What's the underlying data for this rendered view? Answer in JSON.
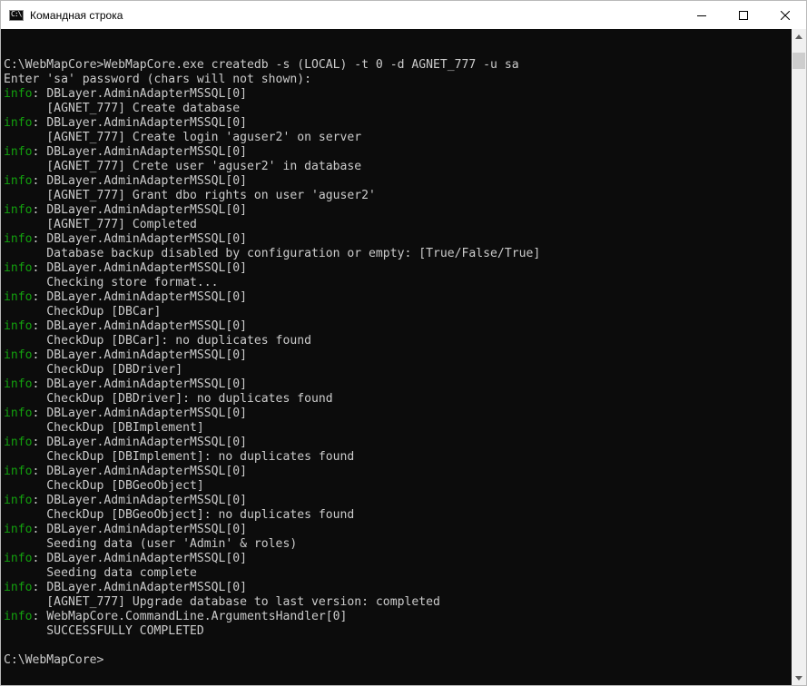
{
  "window": {
    "title": "Командная строка",
    "icon": "cmd-icon",
    "icon_glyph": "C:\\",
    "controls": {
      "minimize_icon": "minimize-icon",
      "maximize_icon": "maximize-icon",
      "close_icon": "close-icon"
    }
  },
  "colors": {
    "background": "#0c0c0c",
    "text": "#cccccc",
    "info_level": "#13a10e",
    "titlebar": "#ffffff"
  },
  "console": {
    "lines": [
      {
        "level": "",
        "text": ""
      },
      {
        "level": "",
        "text": "C:\\WebMapCore>WebMapCore.exe createdb -s (LOCAL) -t 0 -d AGNET_777 -u sa"
      },
      {
        "level": "",
        "text": "Enter 'sa' password (chars will not shown):"
      },
      {
        "level": "info",
        "text": ": DBLayer.AdminAdapterMSSQL[0]"
      },
      {
        "level": "",
        "text": "      [AGNET_777] Create database"
      },
      {
        "level": "info",
        "text": ": DBLayer.AdminAdapterMSSQL[0]"
      },
      {
        "level": "",
        "text": "      [AGNET_777] Create login 'aguser2' on server"
      },
      {
        "level": "info",
        "text": ": DBLayer.AdminAdapterMSSQL[0]"
      },
      {
        "level": "",
        "text": "      [AGNET_777] Crete user 'aguser2' in database"
      },
      {
        "level": "info",
        "text": ": DBLayer.AdminAdapterMSSQL[0]"
      },
      {
        "level": "",
        "text": "      [AGNET_777] Grant dbo rights on user 'aguser2'"
      },
      {
        "level": "info",
        "text": ": DBLayer.AdminAdapterMSSQL[0]"
      },
      {
        "level": "",
        "text": "      [AGNET_777] Completed"
      },
      {
        "level": "info",
        "text": ": DBLayer.AdminAdapterMSSQL[0]"
      },
      {
        "level": "",
        "text": "      Database backup disabled by configuration or empty: [True/False/True]"
      },
      {
        "level": "info",
        "text": ": DBLayer.AdminAdapterMSSQL[0]"
      },
      {
        "level": "",
        "text": "      Checking store format..."
      },
      {
        "level": "info",
        "text": ": DBLayer.AdminAdapterMSSQL[0]"
      },
      {
        "level": "",
        "text": "      CheckDup [DBCar]"
      },
      {
        "level": "info",
        "text": ": DBLayer.AdminAdapterMSSQL[0]"
      },
      {
        "level": "",
        "text": "      CheckDup [DBCar]: no duplicates found"
      },
      {
        "level": "info",
        "text": ": DBLayer.AdminAdapterMSSQL[0]"
      },
      {
        "level": "",
        "text": "      CheckDup [DBDriver]"
      },
      {
        "level": "info",
        "text": ": DBLayer.AdminAdapterMSSQL[0]"
      },
      {
        "level": "",
        "text": "      CheckDup [DBDriver]: no duplicates found"
      },
      {
        "level": "info",
        "text": ": DBLayer.AdminAdapterMSSQL[0]"
      },
      {
        "level": "",
        "text": "      CheckDup [DBImplement]"
      },
      {
        "level": "info",
        "text": ": DBLayer.AdminAdapterMSSQL[0]"
      },
      {
        "level": "",
        "text": "      CheckDup [DBImplement]: no duplicates found"
      },
      {
        "level": "info",
        "text": ": DBLayer.AdminAdapterMSSQL[0]"
      },
      {
        "level": "",
        "text": "      CheckDup [DBGeoObject]"
      },
      {
        "level": "info",
        "text": ": DBLayer.AdminAdapterMSSQL[0]"
      },
      {
        "level": "",
        "text": "      CheckDup [DBGeoObject]: no duplicates found"
      },
      {
        "level": "info",
        "text": ": DBLayer.AdminAdapterMSSQL[0]"
      },
      {
        "level": "",
        "text": "      Seeding data (user 'Admin' & roles)"
      },
      {
        "level": "info",
        "text": ": DBLayer.AdminAdapterMSSQL[0]"
      },
      {
        "level": "",
        "text": "      Seeding data complete"
      },
      {
        "level": "info",
        "text": ": DBLayer.AdminAdapterMSSQL[0]"
      },
      {
        "level": "",
        "text": "      [AGNET_777] Upgrade database to last version: completed"
      },
      {
        "level": "info",
        "text": ": WebMapCore.CommandLine.ArgumentsHandler[0]"
      },
      {
        "level": "",
        "text": "      SUCCESSFULLY COMPLETED"
      },
      {
        "level": "",
        "text": ""
      },
      {
        "level": "",
        "text": "C:\\WebMapCore>"
      }
    ]
  },
  "scrollbar": {
    "up_icon": "scroll-up-icon",
    "down_icon": "scroll-down-icon"
  }
}
